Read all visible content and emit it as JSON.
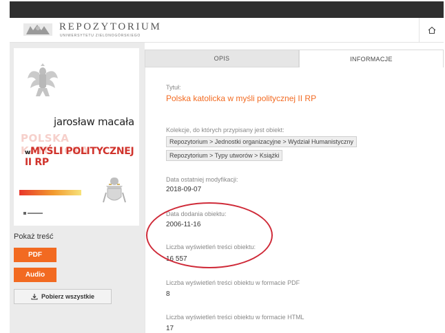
{
  "header": {
    "title": "REPOZYTORIUM",
    "subtitle": "UNIWERSYTETU ZIELONOGÓRSKIEGO",
    "home_icon": "home-icon"
  },
  "cover": {
    "author": "jarosław macała",
    "title_line1": "POLSKA KATOLICKA",
    "title_line2": "MYŚLI POLITYCZNEJ II RP",
    "title_prefix": "w"
  },
  "left": {
    "show_content": "Pokaż treść",
    "pdf": "PDF",
    "audio": "Audio",
    "download_all": "Pobierz wszystkie",
    "download_icon": "download-icon"
  },
  "tabs": [
    {
      "label": "OPIS"
    },
    {
      "label": "INFORMACJE"
    }
  ],
  "info": {
    "title_label": "Tytuł:",
    "title_value": "Polska katolicka w myśli politycznej II RP",
    "collections_label": "Kolekcje, do których przypisany jest obiekt:",
    "collections": [
      "Repozytorium > Jednostki organizacyjne > Wydział Humanistyczny",
      "Repozytorium > Typy utworów > Książki"
    ],
    "modified_label": "Data ostatniej modyfikacji:",
    "modified_value": "2018-09-07",
    "added_label": "Data dodania obiektu:",
    "added_value": "2006-11-16",
    "views_label": "Liczba wyświetleń treści obiektu:",
    "views_value": "16 557",
    "views_pdf_label": "Liczba wyświetleń treści obiektu w formacie PDF",
    "views_pdf_value": "8",
    "views_html_label": "Liczba wyświetleń treści obiektu w formacie HTML",
    "views_html_value": "17"
  },
  "colors": {
    "accent": "#f26a21",
    "annotation": "#cf2a38",
    "topbar": "#2f2f2f"
  }
}
